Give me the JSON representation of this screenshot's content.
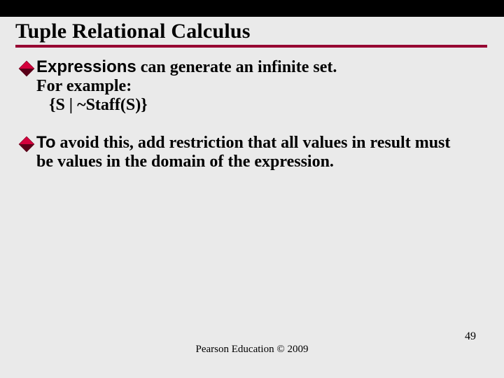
{
  "title": "Tuple Relational Calculus",
  "bullets": [
    {
      "lead": "Expressions",
      "rest": " can generate an infinite set.",
      "lines": [
        "For example:",
        "{S | ~Staff(S)}"
      ]
    },
    {
      "lead": "To",
      "rest": " avoid this, add restriction that all values in result must be values in the domain of the expression.",
      "lines": []
    }
  ],
  "footer": "Pearson Education © 2009",
  "page_number": "49"
}
